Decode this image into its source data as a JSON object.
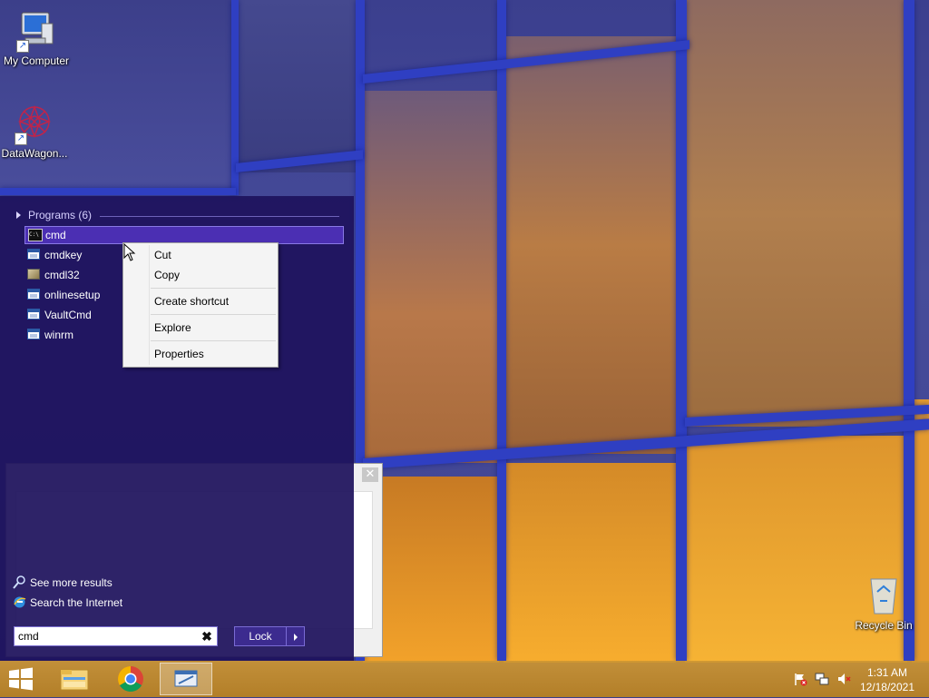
{
  "desktop": {
    "icons": [
      {
        "label": "My Computer",
        "icon": "computer-icon"
      },
      {
        "label": "DataWagon...",
        "icon": "datawagon-icon"
      },
      {
        "label": "Recycle Bin",
        "icon": "recycle-bin-icon"
      }
    ]
  },
  "start_menu": {
    "programs_header": "Programs (6)",
    "programs": [
      {
        "label": "cmd",
        "icon": "console-icon",
        "selected": true
      },
      {
        "label": "cmdkey",
        "icon": "app-window-icon"
      },
      {
        "label": "cmdl32",
        "icon": "utility-icon"
      },
      {
        "label": "onlinesetup",
        "icon": "app-window-icon"
      },
      {
        "label": "VaultCmd",
        "icon": "app-window-icon"
      },
      {
        "label": "winrm",
        "icon": "app-window-icon"
      }
    ],
    "see_more_results": "See more results",
    "search_internet": "Search the Internet",
    "search_value": "cmd",
    "lock_label": "Lock"
  },
  "context_menu": {
    "items": [
      "Cut",
      "Copy",
      "Create shortcut",
      "Explore",
      "Properties"
    ]
  },
  "taskbar": {
    "apps": [
      "start-button",
      "file-explorer-icon",
      "chrome-icon",
      "run-window-icon"
    ],
    "clock_time": "1:31 AM",
    "clock_date": "12/18/2021",
    "tray_icons": [
      "action-center-flag-icon",
      "network-icon",
      "volume-muted-icon"
    ]
  },
  "colors": {
    "start_menu_bg": "#1e125c",
    "selection": "#4b2fb3",
    "taskbar": "#c9932f"
  }
}
